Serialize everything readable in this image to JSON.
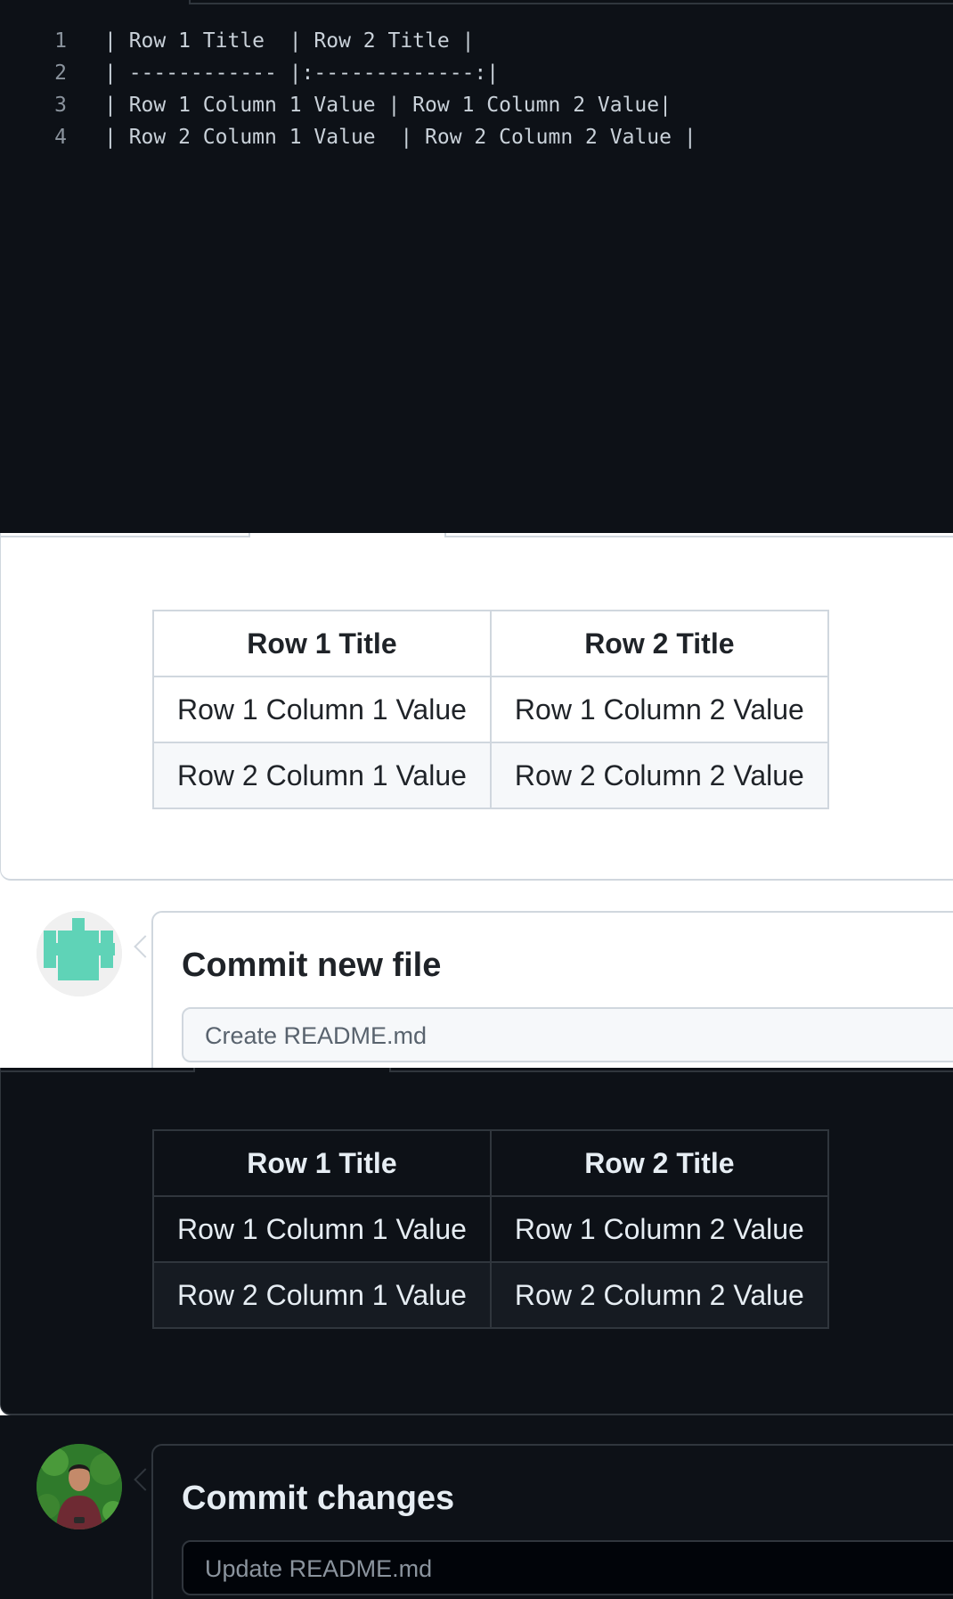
{
  "editor": {
    "lines": [
      {
        "number": "1",
        "text": "| Row 1 Title  | Row 2 Title |"
      },
      {
        "number": "2",
        "text": "| ------------ |:-------------:|"
      },
      {
        "number": "3",
        "text": "| Row 1 Column 1 Value | Row 1 Column 2 Value|"
      },
      {
        "number": "4",
        "text": "| Row 2 Column 1 Value  | Row 2 Column 2 Value |"
      }
    ]
  },
  "light_preview": {
    "table": {
      "headers": [
        "Row 1 Title",
        "Row 2 Title"
      ],
      "rows": [
        [
          "Row 1 Column 1 Value",
          "Row 1 Column 2 Value"
        ],
        [
          "Row 2 Column 1 Value",
          "Row 2 Column 2 Value"
        ]
      ]
    }
  },
  "commit_light": {
    "title": "Commit new file",
    "input_placeholder": "Create README.md"
  },
  "dark_preview": {
    "table": {
      "headers": [
        "Row 1 Title",
        "Row 2 Title"
      ],
      "rows": [
        [
          "Row 1 Column 1 Value",
          "Row 1 Column 2 Value"
        ],
        [
          "Row 2 Column 1 Value",
          "Row 2 Column 2 Value"
        ]
      ]
    }
  },
  "commit_dark": {
    "title": "Commit changes",
    "input_placeholder": "Update README.md"
  },
  "colors": {
    "dark_bg": "#0d1117",
    "light_bg": "#ffffff",
    "identicon": "#5fd3b7"
  }
}
